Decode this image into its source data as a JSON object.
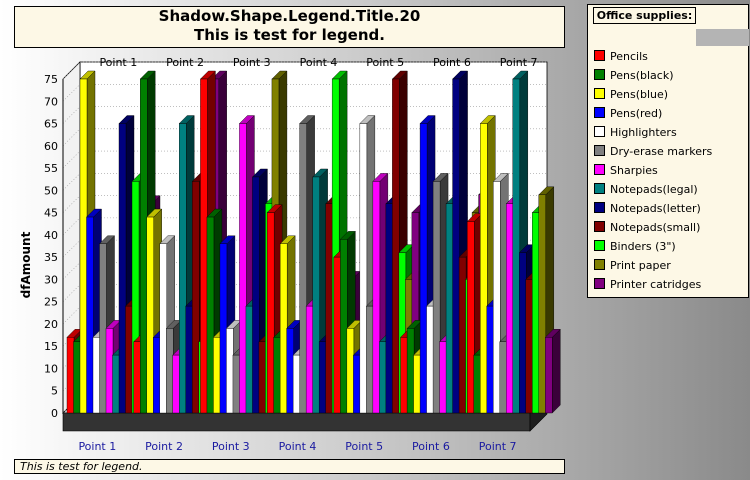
{
  "title": {
    "line1": "Shadow.Shape.Legend.Title.20",
    "line2": "This is test for legend."
  },
  "footer": "This is test for legend.",
  "legend_title": "Office supplies:",
  "chart_data": {
    "type": "bar",
    "ylabel": "dfAmount",
    "ylim": [
      0,
      75
    ],
    "yticks": [
      0,
      5,
      10,
      15,
      20,
      25,
      30,
      35,
      40,
      45,
      50,
      55,
      60,
      65,
      70,
      75
    ],
    "grid": true,
    "legend_position": "right",
    "categories": [
      "Point 1",
      "Point 2",
      "Point 3",
      "Point 4",
      "Point 5",
      "Point 6",
      "Point 7"
    ],
    "series": [
      {
        "name": "Pencils",
        "color": "#ff0000",
        "values": [
          17,
          16,
          75,
          45,
          35,
          17,
          43
        ]
      },
      {
        "name": "Pens(black)",
        "color": "#008000",
        "values": [
          16,
          75,
          44,
          17,
          39,
          19,
          13
        ]
      },
      {
        "name": "Pens(blue)",
        "color": "#ffff00",
        "values": [
          75,
          44,
          17,
          38,
          19,
          13,
          65
        ]
      },
      {
        "name": "Pens(red)",
        "color": "#0000ff",
        "values": [
          44,
          17,
          38,
          19,
          13,
          65,
          24
        ]
      },
      {
        "name": "Highlighters",
        "color": "#ffffff",
        "values": [
          17,
          38,
          19,
          13,
          65,
          24,
          52
        ]
      },
      {
        "name": "Dry-erase markers",
        "color": "#808080",
        "values": [
          38,
          19,
          13,
          65,
          24,
          52,
          16
        ]
      },
      {
        "name": "Sharpies",
        "color": "#ff00ff",
        "values": [
          19,
          13,
          65,
          24,
          52,
          16,
          47
        ]
      },
      {
        "name": "Notepads(legal)",
        "color": "#008080",
        "values": [
          13,
          65,
          24,
          53,
          16,
          47,
          75
        ]
      },
      {
        "name": "Notepads(letter)",
        "color": "#000080",
        "values": [
          65,
          24,
          53,
          16,
          47,
          75,
          36
        ]
      },
      {
        "name": "Notepads(small)",
        "color": "#800000",
        "values": [
          24,
          52,
          16,
          47,
          75,
          35,
          30
        ]
      },
      {
        "name": "Binders (3\")",
        "color": "#00ff00",
        "values": [
          52,
          16,
          47,
          75,
          36,
          30,
          45
        ]
      },
      {
        "name": "Print paper",
        "color": "#808000",
        "values": [
          16,
          47,
          75,
          36,
          30,
          45,
          49
        ]
      },
      {
        "name": "Printer catridges",
        "color": "#800080",
        "values": [
          47,
          75,
          36,
          30,
          45,
          49,
          17
        ]
      }
    ]
  }
}
